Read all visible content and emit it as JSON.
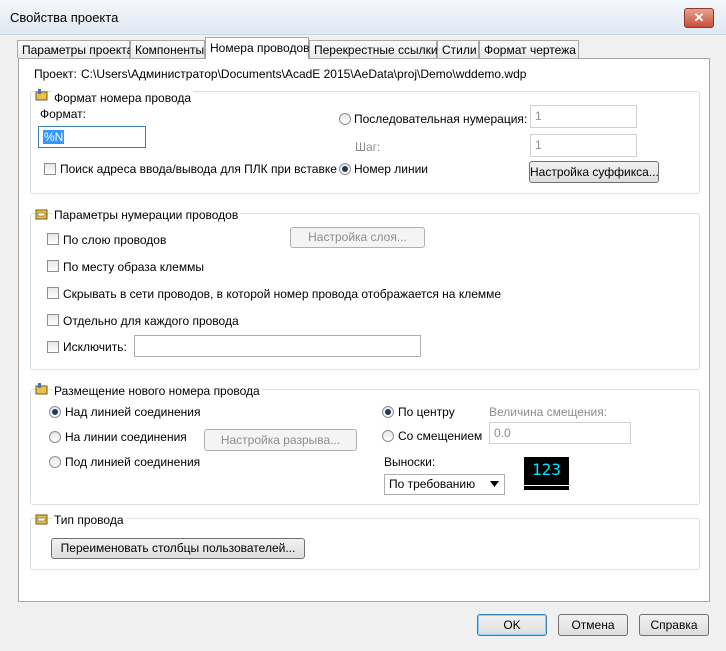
{
  "window": {
    "title": "Свойства проекта",
    "close_glyph": "✕"
  },
  "tabs": [
    {
      "label": "Параметры проекта"
    },
    {
      "label": "Компоненты"
    },
    {
      "label": "Номера проводов"
    },
    {
      "label": "Перекрестные ссылки"
    },
    {
      "label": "Стили"
    },
    {
      "label": "Формат чертежа"
    }
  ],
  "project": {
    "label": "Проект:",
    "path": "C:\\Users\\Администратор\\Documents\\AcadE 2015\\AeData\\proj\\Demo\\wddemo.wdp"
  },
  "wire_format": {
    "title": "Формат номера провода",
    "format_label": "Формат:",
    "format_value": "%N",
    "plc_search_label": "Поиск адреса ввода/вывода для ПЛК при вставке",
    "sequential_label": "Последовательная нумерация:",
    "sequential_value": "1",
    "step_label": "Шаг:",
    "step_value": "1",
    "line_number_label": "Номер линии",
    "suffix_button": "Настройка суффикса..."
  },
  "numbering": {
    "title": "Параметры нумерации проводов",
    "by_layer_label": "По слою проводов",
    "layer_button": "Настройка слоя...",
    "by_terminal_label": "По месту образа клеммы",
    "hide_label": "Скрывать в сети проводов, в которой номер провода отображается на клемме",
    "separate_label": "Отдельно для каждого провода",
    "exclude_label": "Исключить:",
    "exclude_value": ""
  },
  "placement": {
    "title": "Размещение нового номера провода",
    "above_label": "Над линией соединения",
    "on_label": "На линии соединения",
    "break_button": "Настройка разрыва...",
    "below_label": "Под линией соединения",
    "center_label": "По центру",
    "offset_label": "Со смещением",
    "offset_value_label": "Величина смещения:",
    "offset_value": "0.0",
    "leaders_label": "Выноски:",
    "leaders_value": "По требованию",
    "preview_text": "123",
    "preview_text_color": "#00e5ff",
    "preview_bg_color": "#000000"
  },
  "wire_type": {
    "title": "Тип провода",
    "rename_button": "Переименовать столбцы пользователей..."
  },
  "footer": {
    "ok": "OK",
    "cancel": "Отмена",
    "help": "Справка"
  }
}
